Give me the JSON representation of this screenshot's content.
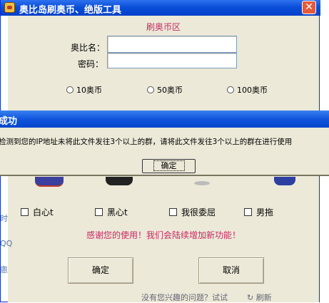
{
  "window": {
    "title": "奥比岛刷奥币、绝版工具",
    "close_symbol": "✕"
  },
  "form": {
    "section_title": "刷奥币区",
    "name_label": "奥比名：",
    "name_value": "",
    "password_label": "密码：",
    "password_value": "",
    "radios": [
      "10奥币",
      "50奥币",
      "100奥币"
    ]
  },
  "checkboxes": [
    "白心t",
    "黑心t",
    "我很委屈",
    "男拖"
  ],
  "thanks": "感谢您的使用！我们会陆续增加新功能！",
  "buttons": {
    "ok": "确定",
    "cancel": "取消"
  },
  "edge_fragments": [
    "时",
    "QQ",
    "悤"
  ],
  "bottom_bar": {
    "text": "没有您兴趣的问题？试试",
    "refresh": "刷新"
  },
  "dialog": {
    "title": "成功",
    "message": "检测到您的IP地址未将此文件发往3个以上的群，请将此文件发往3个以上的群在进行使用",
    "ok": "确定"
  }
}
